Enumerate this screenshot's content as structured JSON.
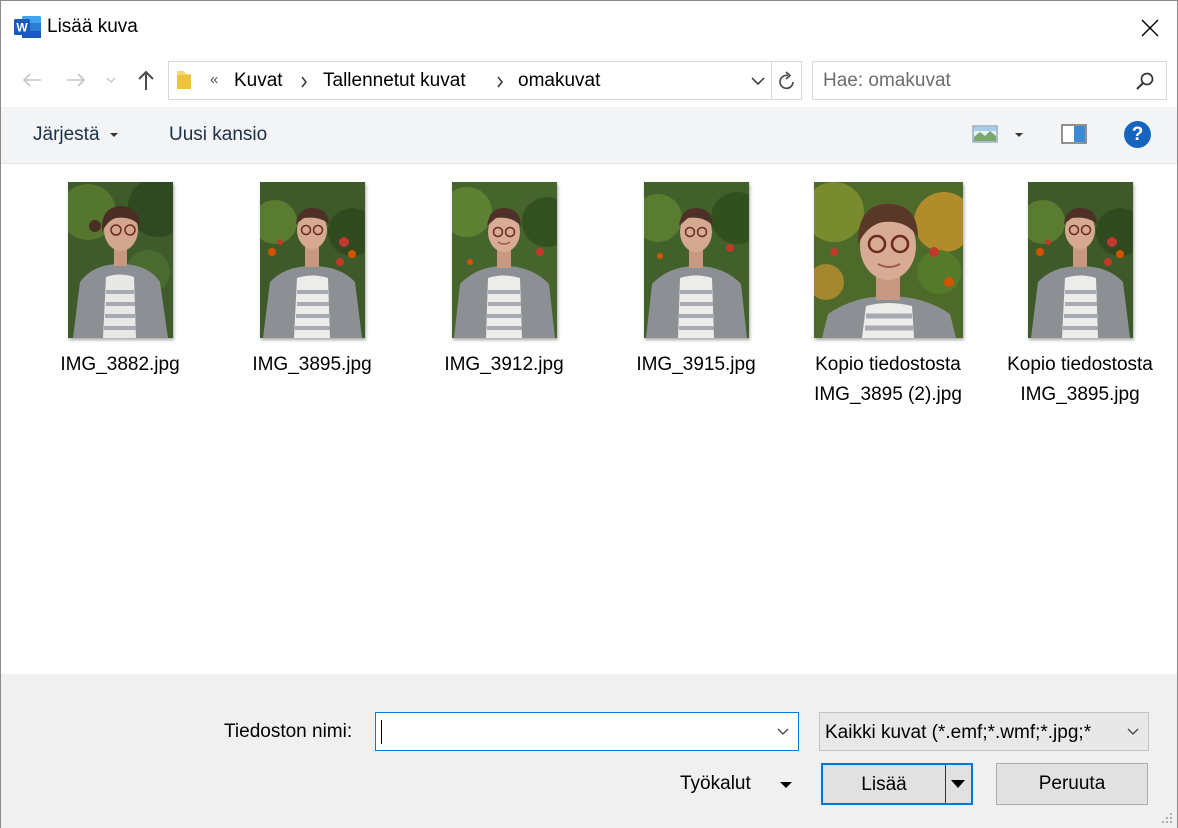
{
  "window": {
    "title": "Lisää kuva"
  },
  "nav": {
    "breadcrumb_overflow": "«",
    "path": [
      "Kuvat",
      "Tallennetut kuvat",
      "omakuvat"
    ]
  },
  "search": {
    "placeholder": "Hae: omakuvat"
  },
  "toolbar": {
    "organize_label": "Järjestä",
    "new_folder_label": "Uusi kansio",
    "help_label": "?"
  },
  "files": [
    {
      "name": "IMG_3882.jpg"
    },
    {
      "name": "IMG_3895.jpg"
    },
    {
      "name": "IMG_3912.jpg"
    },
    {
      "name": "IMG_3915.jpg"
    },
    {
      "name": "Kopio tiedostosta IMG_3895 (2).jpg"
    },
    {
      "name": "Kopio tiedostosta IMG_3895.jpg"
    }
  ],
  "bottom": {
    "filename_label": "Tiedoston nimi:",
    "filename_value": "",
    "filetype_value": "Kaikki kuvat (*.emf;*.wmf;*.jpg;*",
    "tools_label": "Työkalut",
    "insert_label": "Lisää",
    "cancel_label": "Peruuta"
  },
  "colors": {
    "accent": "#0078d7",
    "help": "#1565c0",
    "word": "#185abd"
  }
}
